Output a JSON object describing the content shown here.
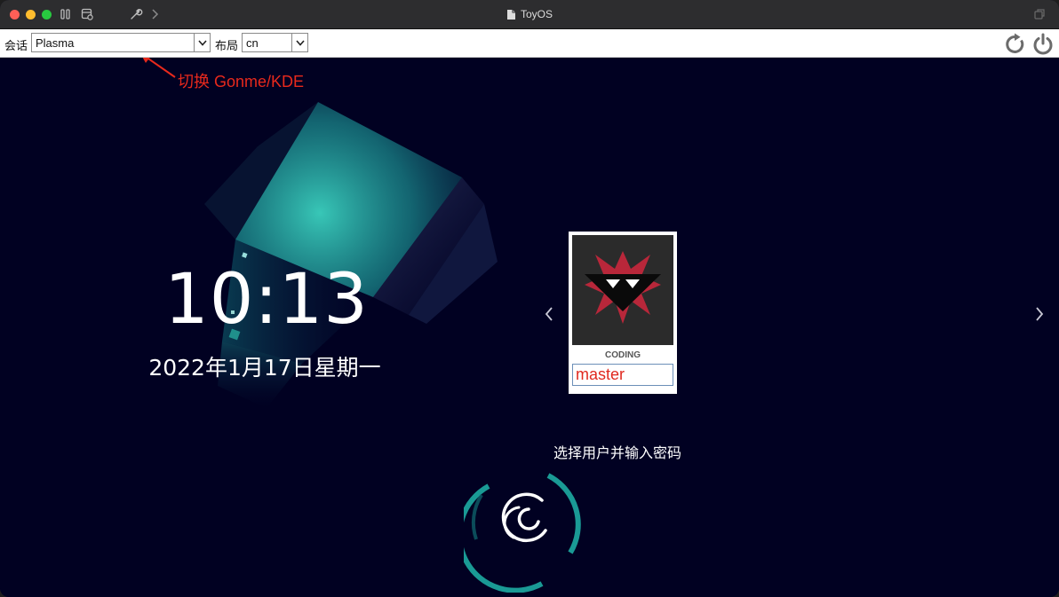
{
  "window": {
    "title": "ToyOS"
  },
  "toolbar": {
    "session_label": "会话",
    "session_value": "Plasma",
    "layout_label": "布局",
    "layout_value": "cn"
  },
  "annotation": {
    "text": "切换 Gonme/KDE"
  },
  "lockscreen": {
    "time": "10:13",
    "date": "2022年1月17日星期一",
    "user_name": "CODING",
    "password_value": "master",
    "prompt": "选择用户并输入密码"
  },
  "icons": {
    "toolbar": [
      "sidebar-toggle-icon",
      "settings-panel-icon",
      "wrench-icon",
      "chevron-right-icon"
    ],
    "window_buttons": [
      "restart-icon",
      "power-icon"
    ],
    "carousel": [
      "chevron-left-icon",
      "chevron-right-icon"
    ],
    "desktop": [
      "debian-swirl-icon"
    ]
  },
  "colors": {
    "desktop_bg": "#010122",
    "teal_accent": "#1ba6a0",
    "annotation_red": "#e8291c",
    "password_text": "#e0291f"
  }
}
